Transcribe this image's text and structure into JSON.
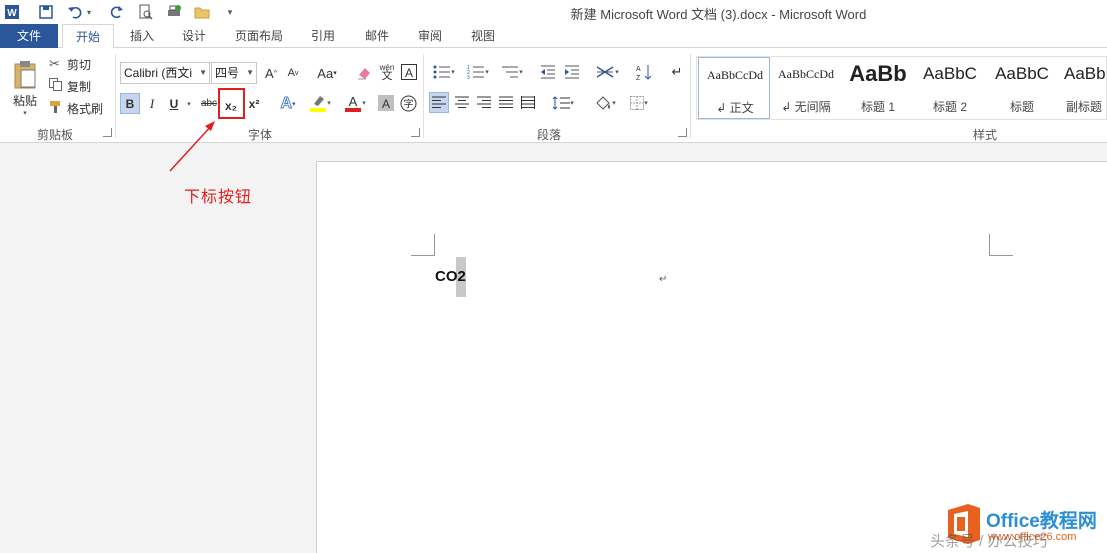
{
  "window": {
    "title": "新建 Microsoft Word 文档 (3).docx - Microsoft Word"
  },
  "quick_access": [
    "word-app-icon",
    "save-icon",
    "undo-icon",
    "redo-icon",
    "print-preview-icon",
    "quick-print-icon",
    "open-folder-icon",
    "customize-icon"
  ],
  "tabs": [
    {
      "label": "文件"
    },
    {
      "label": "开始"
    },
    {
      "label": "插入"
    },
    {
      "label": "设计"
    },
    {
      "label": "页面布局"
    },
    {
      "label": "引用"
    },
    {
      "label": "邮件"
    },
    {
      "label": "审阅"
    },
    {
      "label": "视图"
    }
  ],
  "clipboard": {
    "paste_label": "粘贴",
    "cut_label": "剪切",
    "copy_label": "复制",
    "format_painter_label": "格式刷",
    "group_label": "剪贴板"
  },
  "font": {
    "font_name": "Calibri (西文i",
    "font_size": "四号",
    "group_label": "字体",
    "bold": "B",
    "italic": "I",
    "underline": "U",
    "strike": "abc",
    "subscript": "x₂",
    "superscript": "x²",
    "grow": "A",
    "shrink": "A",
    "case": "Aa",
    "phonetic": "wén",
    "font_color_glyph": "A",
    "shade_glyph": "A",
    "enclose_glyph": "字"
  },
  "paragraph": {
    "group_label": "段落"
  },
  "styles": {
    "group_label": "样式",
    "items": [
      {
        "sample": "AaBbCcDd",
        "name": "↲ 正文"
      },
      {
        "sample": "AaBbCcDd",
        "name": "↲ 无间隔"
      },
      {
        "sample": "AaBb",
        "name": "标题 1"
      },
      {
        "sample": "AaBbC",
        "name": "标题 2"
      },
      {
        "sample": "AaBbC",
        "name": "标题"
      },
      {
        "sample": "AaBb",
        "name": "副标题"
      }
    ]
  },
  "document": {
    "text": "CO2",
    "para_mark": "↵"
  },
  "annotation": {
    "label": "下标按钮",
    "color": "#e0201f"
  },
  "watermark": {
    "line1": "Office教程网",
    "line2": "www.office26.com",
    "overlay": "头条号 / 办公技巧"
  },
  "colors": {
    "accent": "#2b579a",
    "annotation": "#e0201f"
  }
}
